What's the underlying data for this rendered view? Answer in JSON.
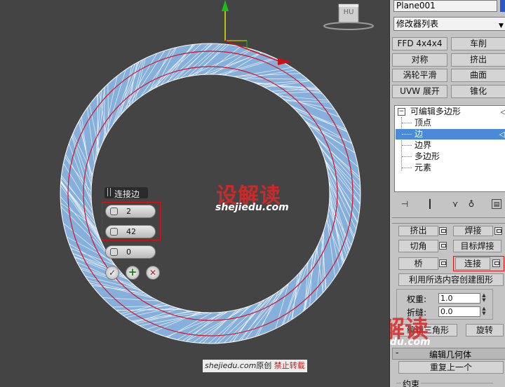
{
  "viewport": {
    "caddy": {
      "title": "连接边",
      "segments": "2",
      "pinch": "42",
      "slide": "0"
    },
    "watermark": {
      "logo": "设解读",
      "url": "shejiedu.com",
      "footer_site": "shejiedu.com",
      "footer_original": "原创",
      "footer_forbid": "禁止转载"
    },
    "viewcube_label": "HU"
  },
  "panel": {
    "object_name": "Plane001",
    "modifier_list": "修改器列表",
    "buttons": [
      "FFD 4x4x4",
      "车削",
      "对称",
      "挤出",
      "涡轮平滑",
      "曲面",
      "UVW 展开",
      "锥化"
    ],
    "stack": {
      "root": "可编辑多边形",
      "items": [
        "顶点",
        "边",
        "边界",
        "多边形",
        "元素"
      ],
      "selected": "边"
    },
    "edit_edges": {
      "extrude": "挤出",
      "weld": "焊接",
      "chamfer": "切角",
      "target_weld": "目标焊接",
      "bridge": "桥",
      "connect": "连接",
      "create_shape": "利用所选内容创建图形",
      "weight_label": "权重:",
      "weight_value": "1.0",
      "crease_label": "折缝:",
      "crease_value": "0.0",
      "edit_tri": "编辑三角形",
      "turn": "旋转"
    },
    "edit_geometry": {
      "title": "编辑几何体",
      "repeat_last": "重复上一个",
      "constraints": "约束"
    }
  }
}
